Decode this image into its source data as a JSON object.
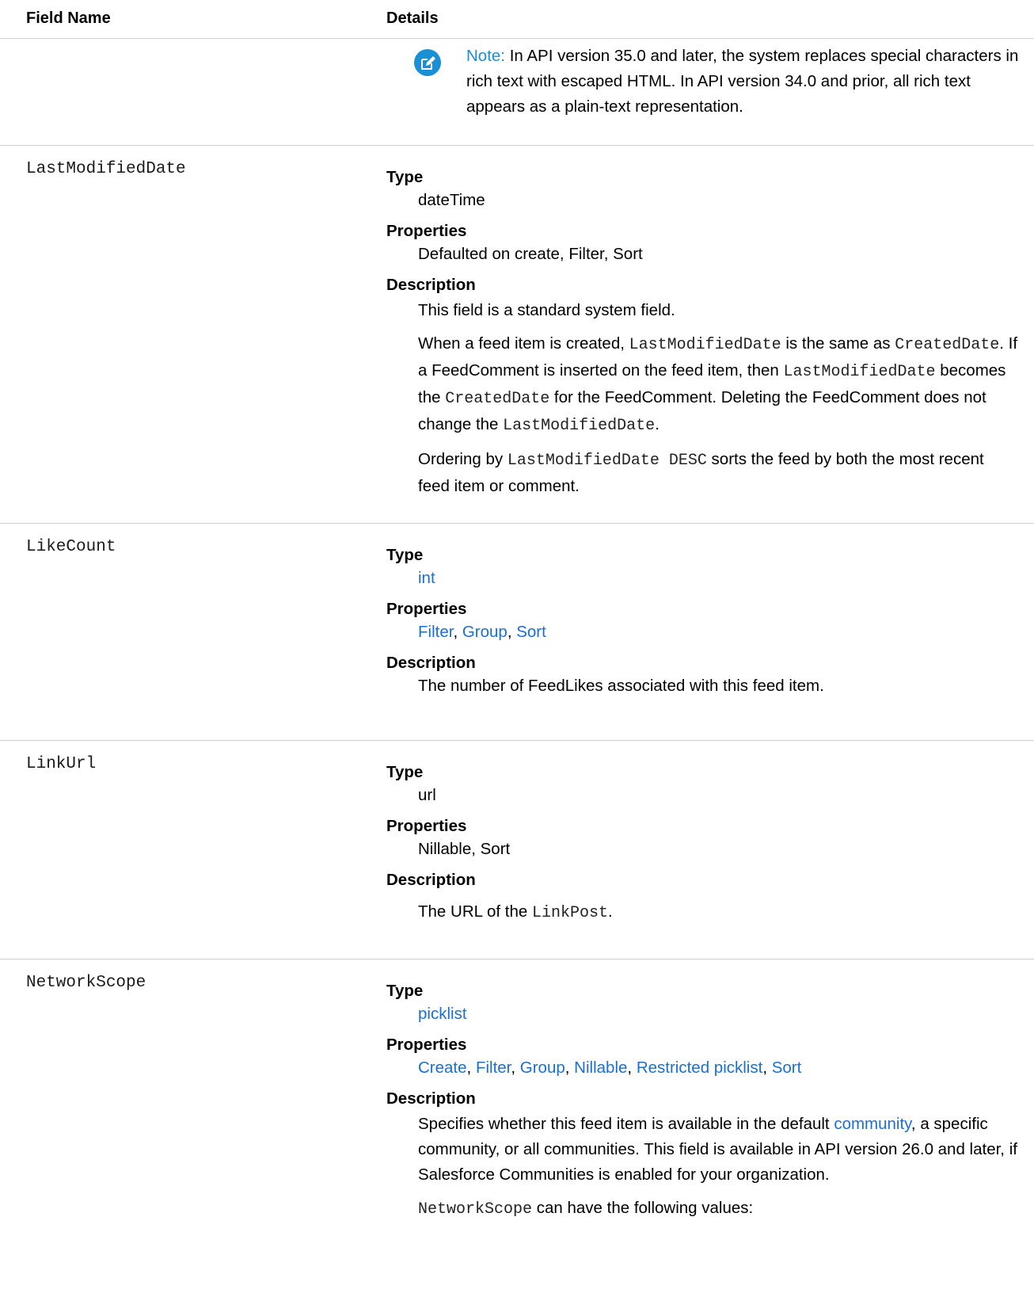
{
  "header": {
    "field_name": "Field Name",
    "details": "Details"
  },
  "note": {
    "label": "Note:",
    "text": " In API version 35.0 and later, the system replaces special characters in rich text with escaped HTML. In API version 34.0 and prior, all rich text appears as a plain-text representation."
  },
  "labels": {
    "type": "Type",
    "properties": "Properties",
    "description": "Description"
  },
  "fields": {
    "last_modified": {
      "name": "LastModifiedDate",
      "type": "dateTime",
      "properties": "Defaulted on create, Filter, Sort",
      "desc1": "This field is a standard system field.",
      "p2": {
        "t1": "When a feed item is created, ",
        "c1": "LastModifiedDate",
        "t2": " is the same as ",
        "c2": "CreatedDate",
        "t3": ". If a FeedComment is inserted on the feed item, then ",
        "c3": "LastModifiedDate",
        "t4": " becomes the ",
        "c4": "CreatedDate",
        "t5": " for the FeedComment. Deleting the FeedComment does not change the ",
        "c5": "LastModifiedDate",
        "t6": "."
      },
      "p3": {
        "t1": "Ordering by ",
        "c1": "LastModifiedDate DESC",
        "t2": " sorts the feed by both the most recent feed item or comment."
      }
    },
    "like_count": {
      "name": "LikeCount",
      "type": "int",
      "properties": [
        "Filter",
        "Group",
        "Sort"
      ],
      "description": "The number of FeedLikes associated with this feed item."
    },
    "link_url": {
      "name": "LinkUrl",
      "type": "url",
      "properties": "Nillable, Sort",
      "desc": {
        "t1": "The URL of the ",
        "c1": "LinkPost",
        "t2": "."
      }
    },
    "network_scope": {
      "name": "NetworkScope",
      "type": "picklist",
      "properties": [
        "Create",
        "Filter",
        "Group",
        "Nillable",
        "Restricted picklist",
        "Sort"
      ],
      "desc": {
        "t1": "Specifies whether this feed item is available in the default ",
        "link": "community",
        "t2": ", a specific community, or all communities. This field is available in API version 26.0 and later, if Salesforce Communities is enabled for your organization."
      },
      "p2": {
        "c1": "NetworkScope",
        "t1": " can have the following values:"
      }
    }
  },
  "colors": {
    "link": "#1a6fd6",
    "note_accent": "#1a8fd6"
  },
  "icons": {
    "note": "edit-pencil-icon"
  }
}
